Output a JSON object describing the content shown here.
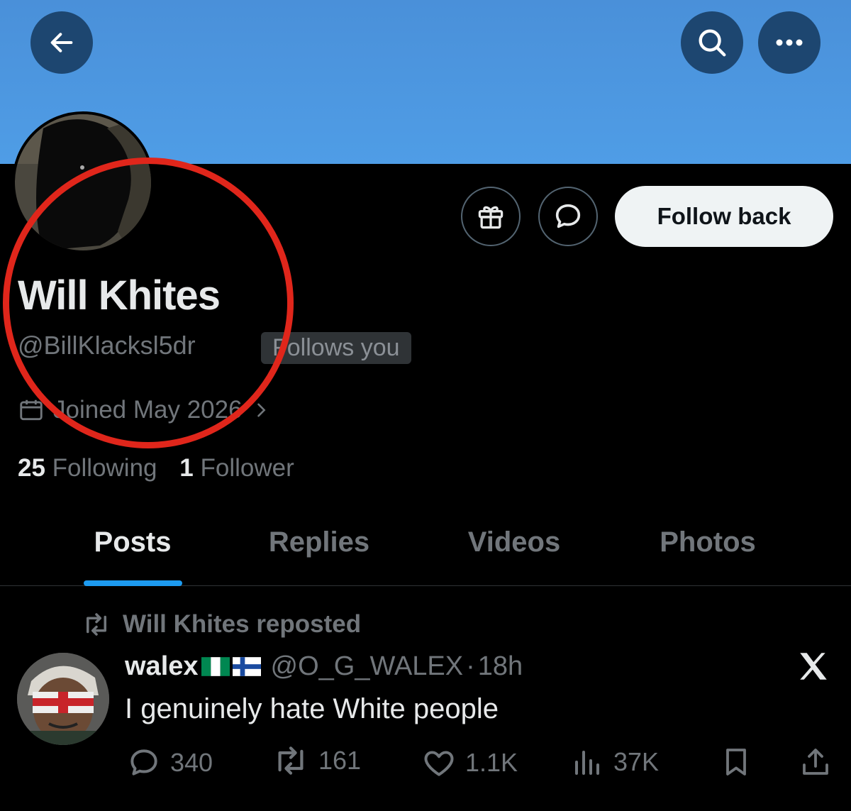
{
  "colors": {
    "accent": "#1d9bf0",
    "highlight_circle": "#e0261b",
    "banner": "#4f9de6"
  },
  "header": {
    "back_icon": "arrow-left-icon",
    "search_icon": "search-icon",
    "more_icon": "more-horizontal-icon"
  },
  "profile": {
    "display_name": "Will Khites",
    "handle": "@BillKlacksl5dr",
    "follows_you": "Follows you",
    "joined": "Joined May 2026",
    "following_count": "25",
    "following_label": "Following",
    "followers_count": "1",
    "followers_label": "Follower",
    "follow_back_label": "Follow back"
  },
  "tabs": [
    {
      "label": "Posts",
      "active": true
    },
    {
      "label": "Replies",
      "active": false
    },
    {
      "label": "Videos",
      "active": false
    },
    {
      "label": "Photos",
      "active": false
    }
  ],
  "post": {
    "repost_label": "Will Khites reposted",
    "author_name": "walex",
    "author_handle": "@O_G_WALEX",
    "separator": "·",
    "time": "18h",
    "text": "I genuinely hate White people",
    "metrics": {
      "replies": "340",
      "reposts": "161",
      "likes": "1.1K",
      "views": "37K"
    }
  }
}
